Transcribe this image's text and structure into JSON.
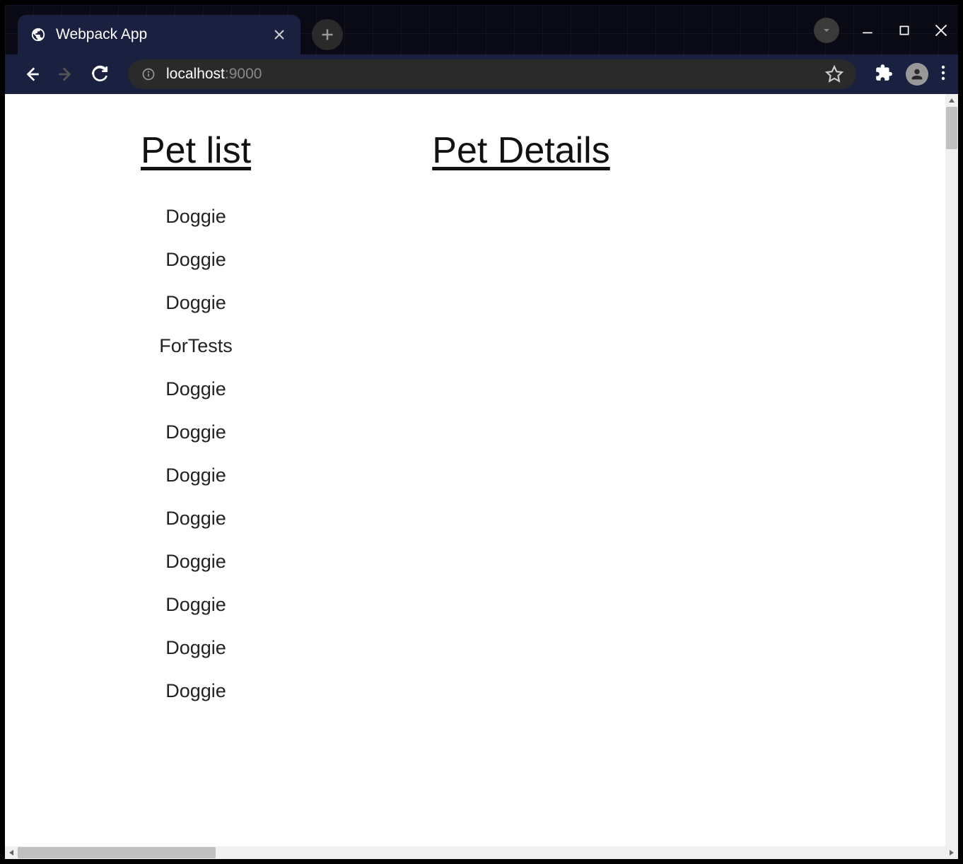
{
  "browser": {
    "tab_title": "Webpack App",
    "url_host": "localhost",
    "url_port": ":9000"
  },
  "page": {
    "list_heading": "Pet list",
    "details_heading": "Pet Details",
    "pets": [
      "Doggie",
      "Doggie",
      "Doggie",
      "ForTests",
      "Doggie",
      "Doggie",
      "Doggie",
      "Doggie",
      "Doggie",
      "Doggie",
      "Doggie",
      "Doggie"
    ]
  }
}
